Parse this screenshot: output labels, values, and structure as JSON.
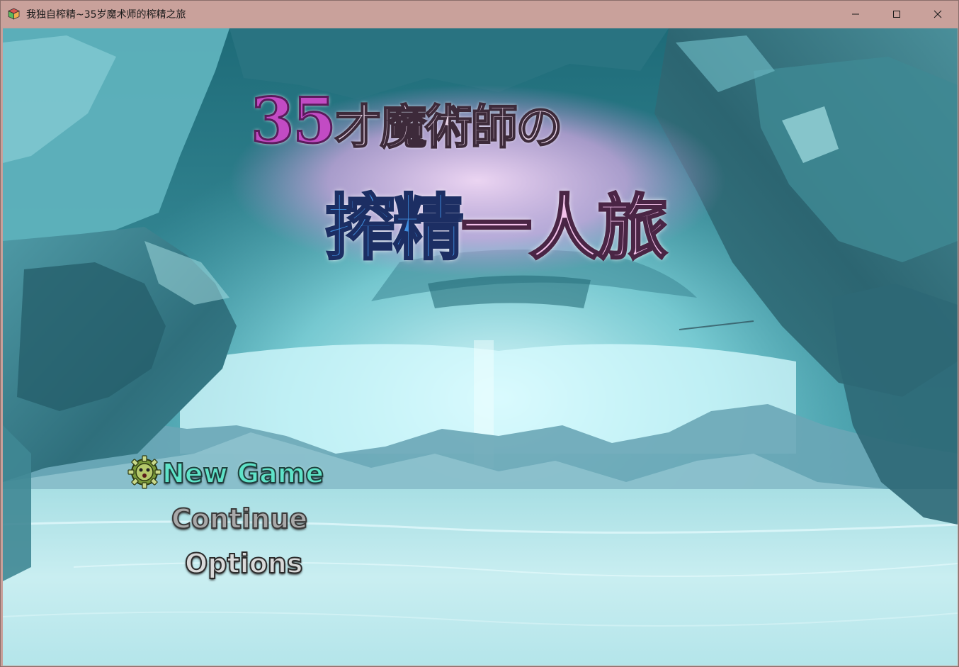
{
  "window": {
    "title": "我独自榨精~35岁魔术师的榨精之旅",
    "app_icon": "game-cube-icon",
    "controls": {
      "minimize_icon": "minimize-icon",
      "maximize_icon": "maximize-icon",
      "close_icon": "close-icon"
    },
    "colors": {
      "titlebar_bg": "#c9a19b"
    }
  },
  "game": {
    "logo": {
      "line1_number": "35",
      "line1_rest": "才魔術師の",
      "line2_blue": "搾精",
      "line2_pink": "一人旅"
    },
    "menu": {
      "cursor_icon": "gear-cursor-icon",
      "items": [
        {
          "label": "New Game",
          "selected": true
        },
        {
          "label": "Continue",
          "selected": false
        },
        {
          "label": "Options",
          "selected": false
        }
      ]
    },
    "colors": {
      "selected": "#5fe3c8",
      "disabled": "#a9a9a9",
      "normal": "#d9d9d9",
      "logo_purple": "#c24bc4",
      "logo_blue": "#3f8ee0",
      "logo_pink": "#f3c1ea"
    }
  }
}
